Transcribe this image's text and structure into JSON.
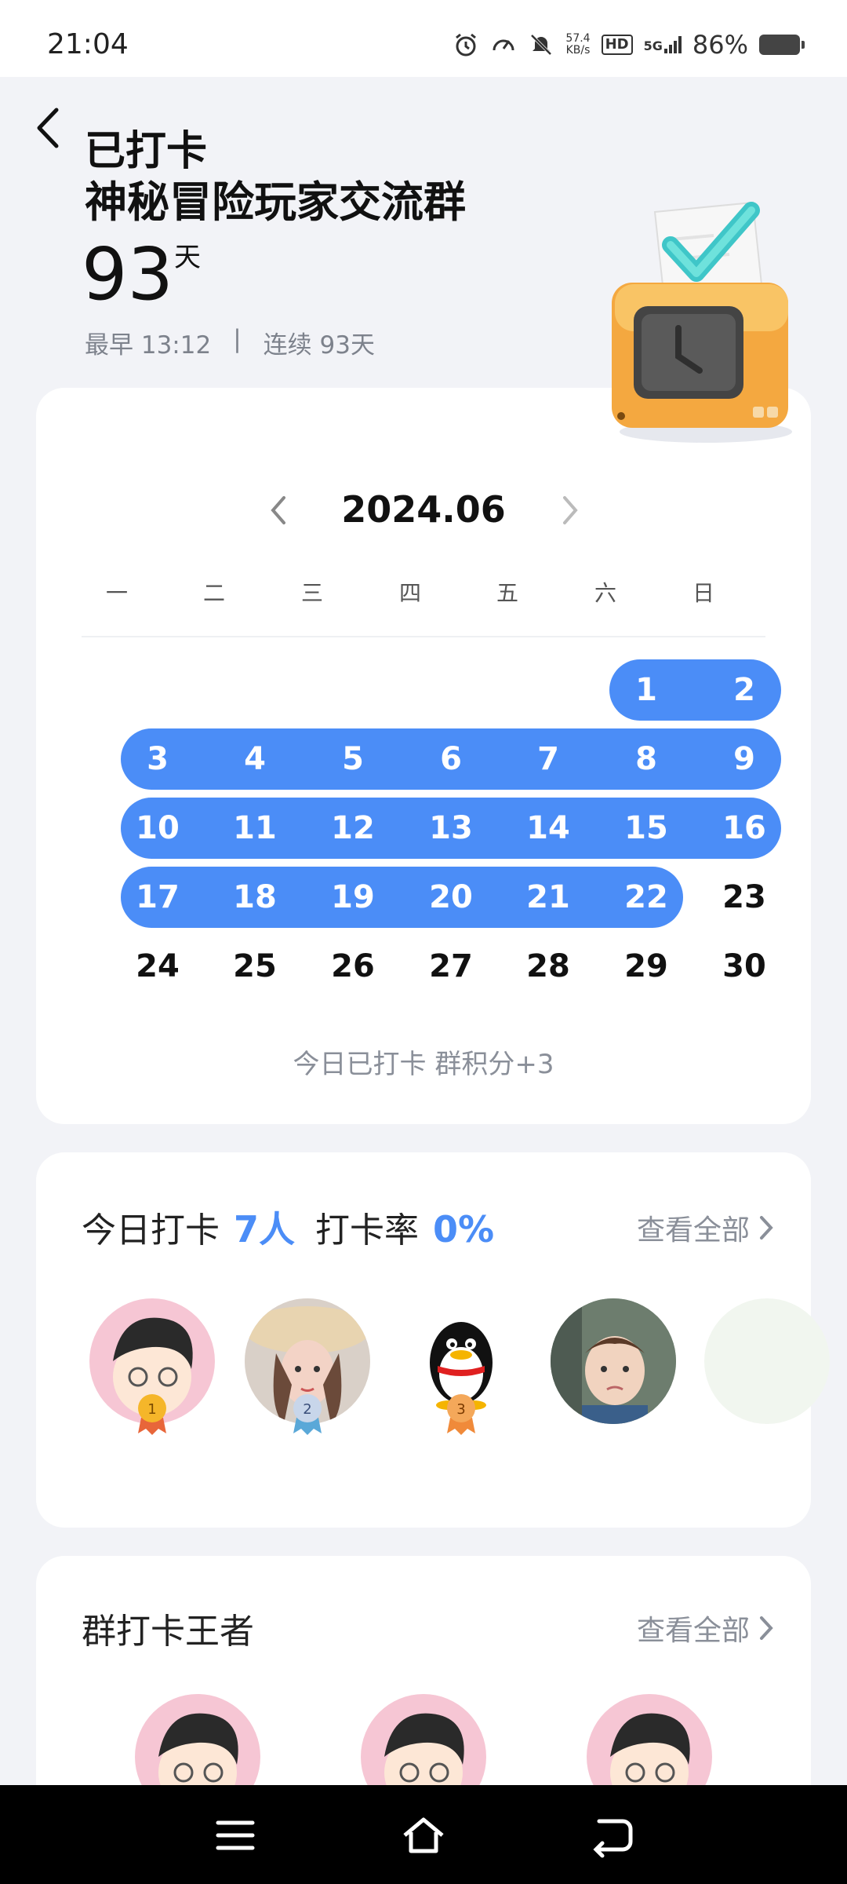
{
  "status_bar": {
    "time": "21:04",
    "net_speed_value": "57.4",
    "net_speed_unit": "KB/s",
    "hd_label": "HD",
    "signal_label": "5G",
    "battery_percent": "86%",
    "icons": [
      "alarm-icon",
      "speedometer-icon",
      "mute-icon",
      "hd-icon",
      "signal-icon",
      "battery-icon"
    ]
  },
  "header": {
    "title": "已打卡",
    "group_name": "神秘冒险玩家交流群",
    "days": "93",
    "days_unit": "天",
    "earliest": "最早 13:12",
    "separator": "|",
    "streak": "连续 93天"
  },
  "calendar": {
    "month": "2024.06",
    "weekdays": [
      "一",
      "二",
      "三",
      "四",
      "五",
      "六",
      "日"
    ],
    "days": [
      "1",
      "2",
      "3",
      "4",
      "5",
      "6",
      "7",
      "8",
      "9",
      "10",
      "11",
      "12",
      "13",
      "14",
      "15",
      "16",
      "17",
      "18",
      "19",
      "20",
      "21",
      "22",
      "23",
      "24",
      "25",
      "26",
      "27",
      "28",
      "29",
      "30"
    ],
    "checked_through": 22,
    "accent_color": "#4b8df7",
    "today_note": "今日已打卡  群积分+3"
  },
  "today_checkin": {
    "label": "今日打卡",
    "count": "7人",
    "rate_label": "打卡率",
    "rate": "0%",
    "view_all": "查看全部",
    "medal_numbers": [
      "1",
      "2",
      "3"
    ]
  },
  "kings": {
    "title": "群打卡王者",
    "view_all": "查看全部"
  }
}
